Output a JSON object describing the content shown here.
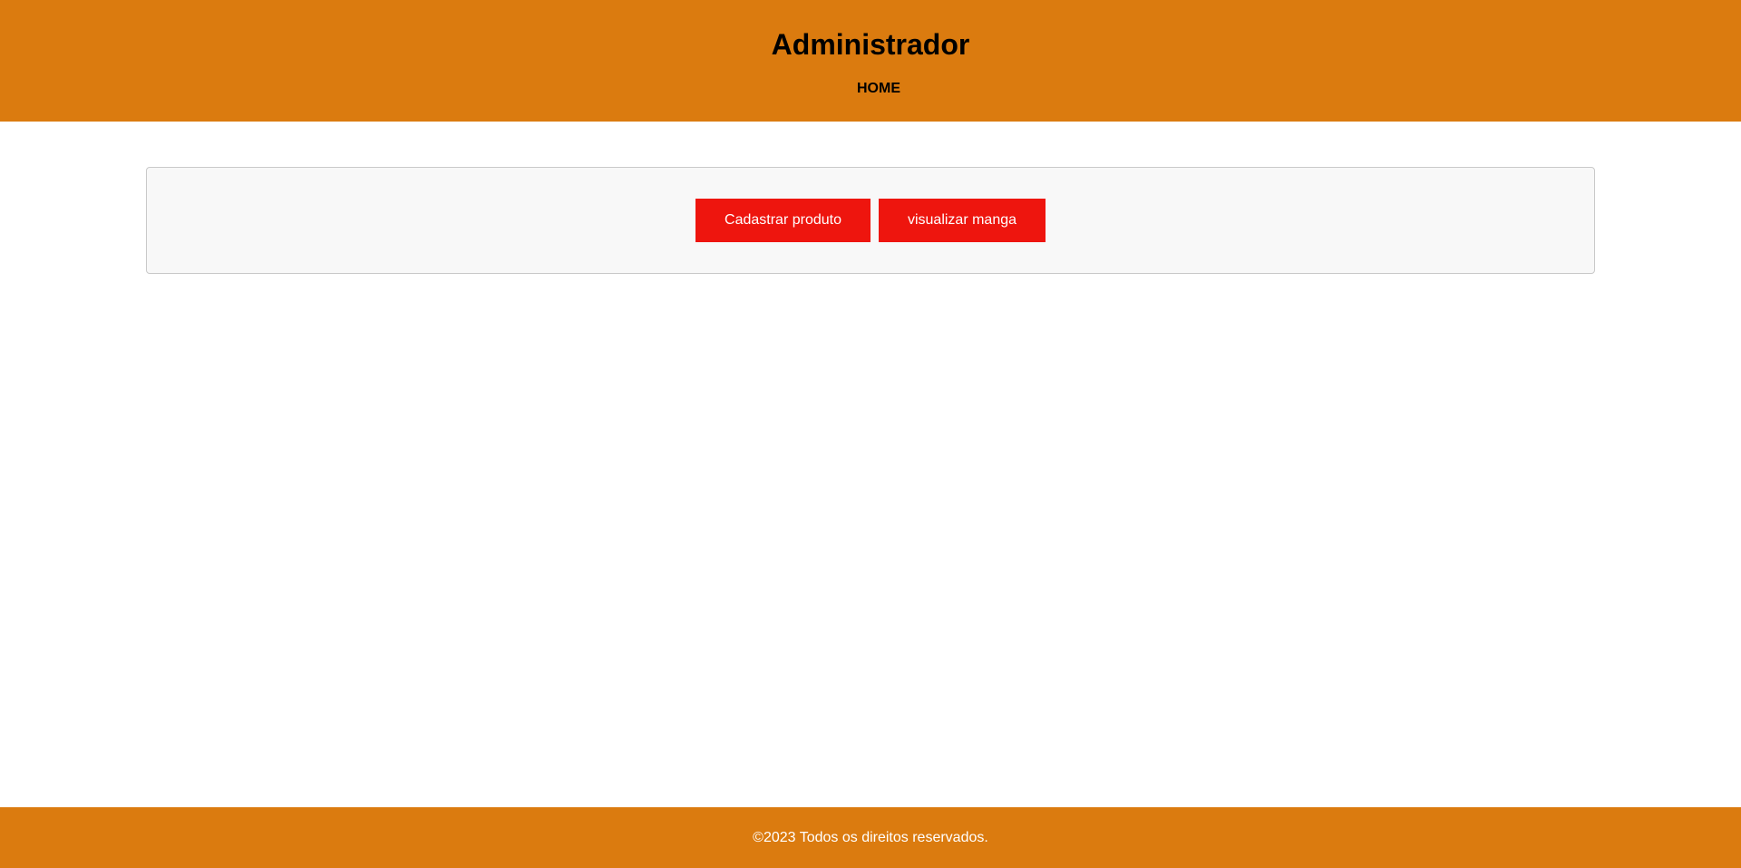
{
  "header": {
    "title": "Administrador",
    "nav": [
      {
        "label": "HOME"
      }
    ]
  },
  "panel": {
    "buttons": [
      {
        "label": "Cadastrar produto"
      },
      {
        "label": "visualizar manga"
      }
    ]
  },
  "footer": {
    "text": "©2023 Todos os direitos reservados."
  },
  "colors": {
    "header_bg": "#db7b0f",
    "footer_bg": "#db7b0f",
    "button_bg": "#ee150e",
    "panel_bg": "#f8f8f8"
  }
}
